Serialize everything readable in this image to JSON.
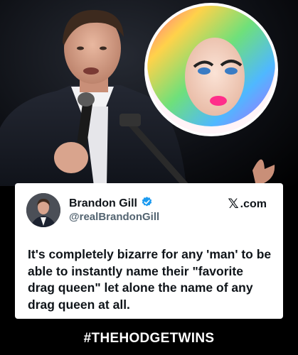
{
  "tweet": {
    "author_name": "Brandon Gill",
    "handle": "@realBrandonGill",
    "source_label": ".com",
    "text": "It's completely bizarre for any 'man' to be able to instantly name their \"favorite drag queen\" let alone the name of any drag queen at all.",
    "verified": true
  },
  "icons": {
    "verified": "verified-badge-icon",
    "brand": "x-logo-icon"
  },
  "hashtag": "#THEHODGETWINS",
  "colors": {
    "background": "#000000",
    "card": "#ffffff",
    "verified": "#1d9bf0",
    "text": "#0f1419",
    "muted": "#536471"
  }
}
